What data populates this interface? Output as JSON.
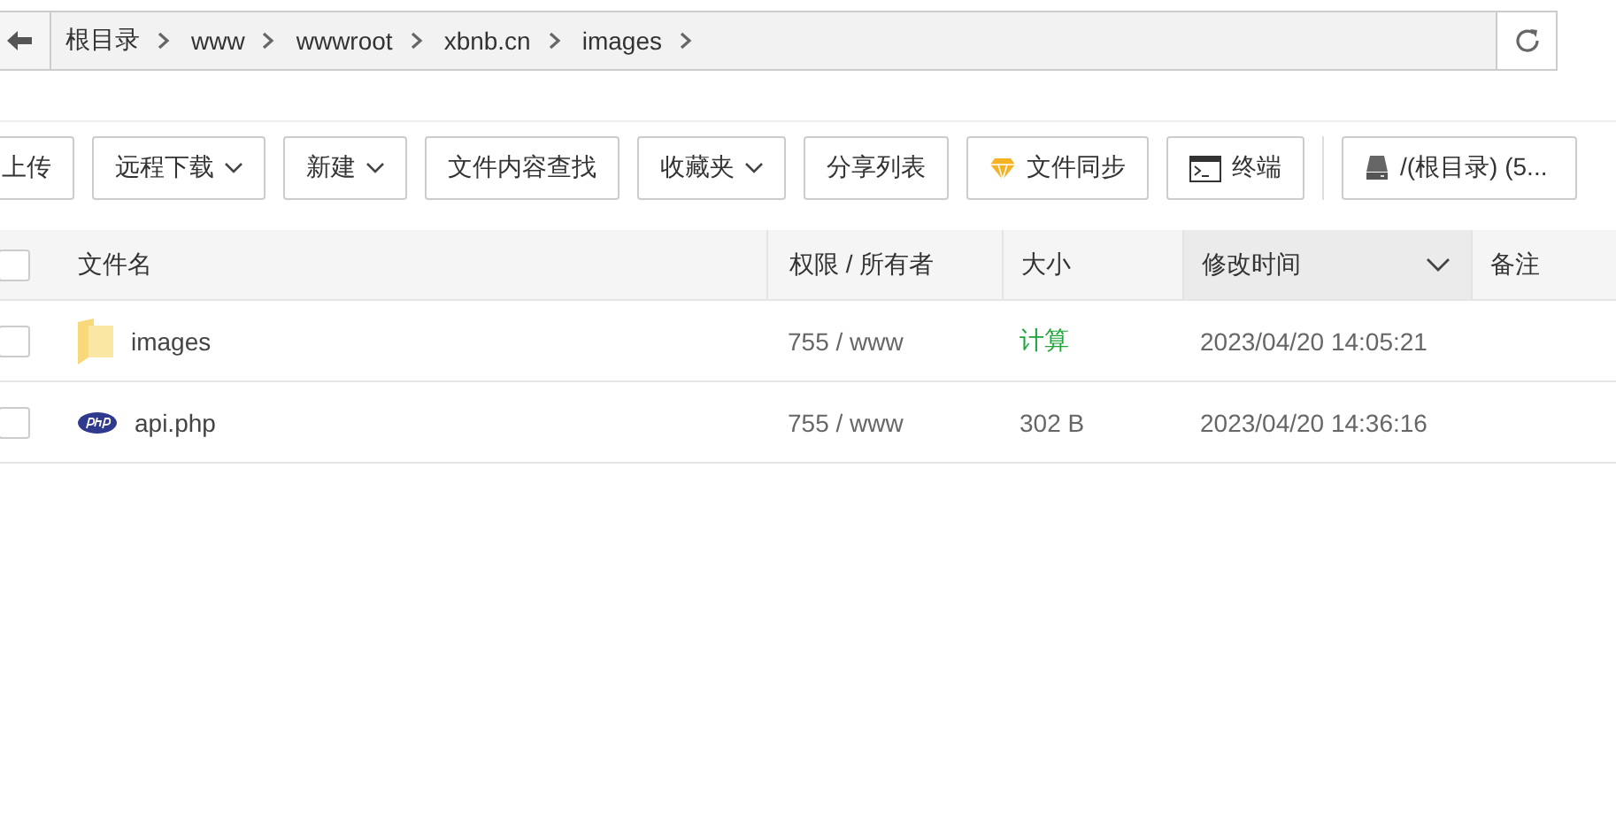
{
  "breadcrumb": [
    "根目录",
    "www",
    "wwwroot",
    "xbnb.cn",
    "images"
  ],
  "toolbar": [
    {
      "label": "上传",
      "kind": "plain"
    },
    {
      "label": "远程下载",
      "kind": "menu"
    },
    {
      "label": "新建",
      "kind": "menu"
    },
    {
      "label": "文件内容查找",
      "kind": "plain"
    },
    {
      "label": "收藏夹",
      "kind": "menu"
    },
    {
      "label": "分享列表",
      "kind": "plain"
    },
    {
      "label": "文件同步",
      "kind": "gem"
    },
    {
      "label": "终端",
      "kind": "terminal"
    },
    {
      "label": "/(根目录) (5...",
      "kind": "disk"
    }
  ],
  "table": {
    "select_all": {
      "checked": false
    },
    "columns": [
      {
        "label": "文件名",
        "sorted": false
      },
      {
        "label": "权限 / 所有者",
        "sorted": false
      },
      {
        "label": "大小",
        "sorted": false
      },
      {
        "label": "修改时间",
        "sorted": true
      },
      {
        "label": "备注",
        "sorted": false
      }
    ],
    "rows": [
      {
        "kind": "folder",
        "checked": false,
        "name": "images",
        "permission": "755 / www",
        "size": "计算",
        "modified": "2023/04/20 14:05:21"
      },
      {
        "kind": "php",
        "checked": false,
        "name": "api.php",
        "permission": "755 / www",
        "size": "302 B",
        "modified": "2023/04/20 14:36:16"
      }
    ]
  }
}
